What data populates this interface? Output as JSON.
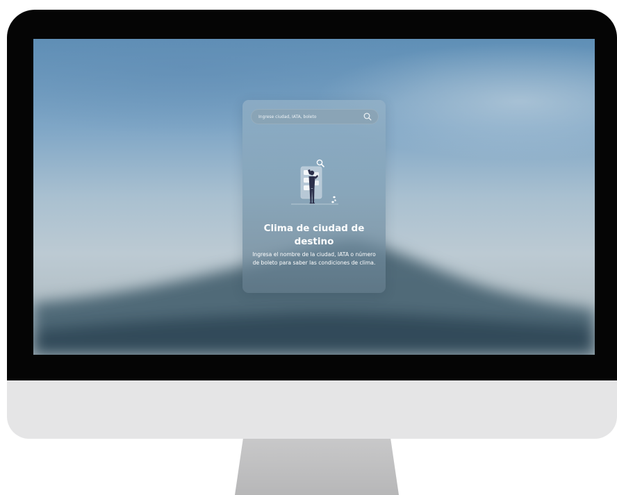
{
  "search": {
    "placeholder": "Ingrese ciudad, IATA, boleto",
    "icon": "search-icon"
  },
  "card": {
    "title": "Clima de ciudad de destino",
    "description": "Ingresa el nombre de la ciudad, IATA o número de boleto para saber las condiciones de clima."
  },
  "colors": {
    "card_text": "#ffffff",
    "illustration_figure": "#2b2f4a",
    "illustration_panel": "#dfe6ee"
  }
}
